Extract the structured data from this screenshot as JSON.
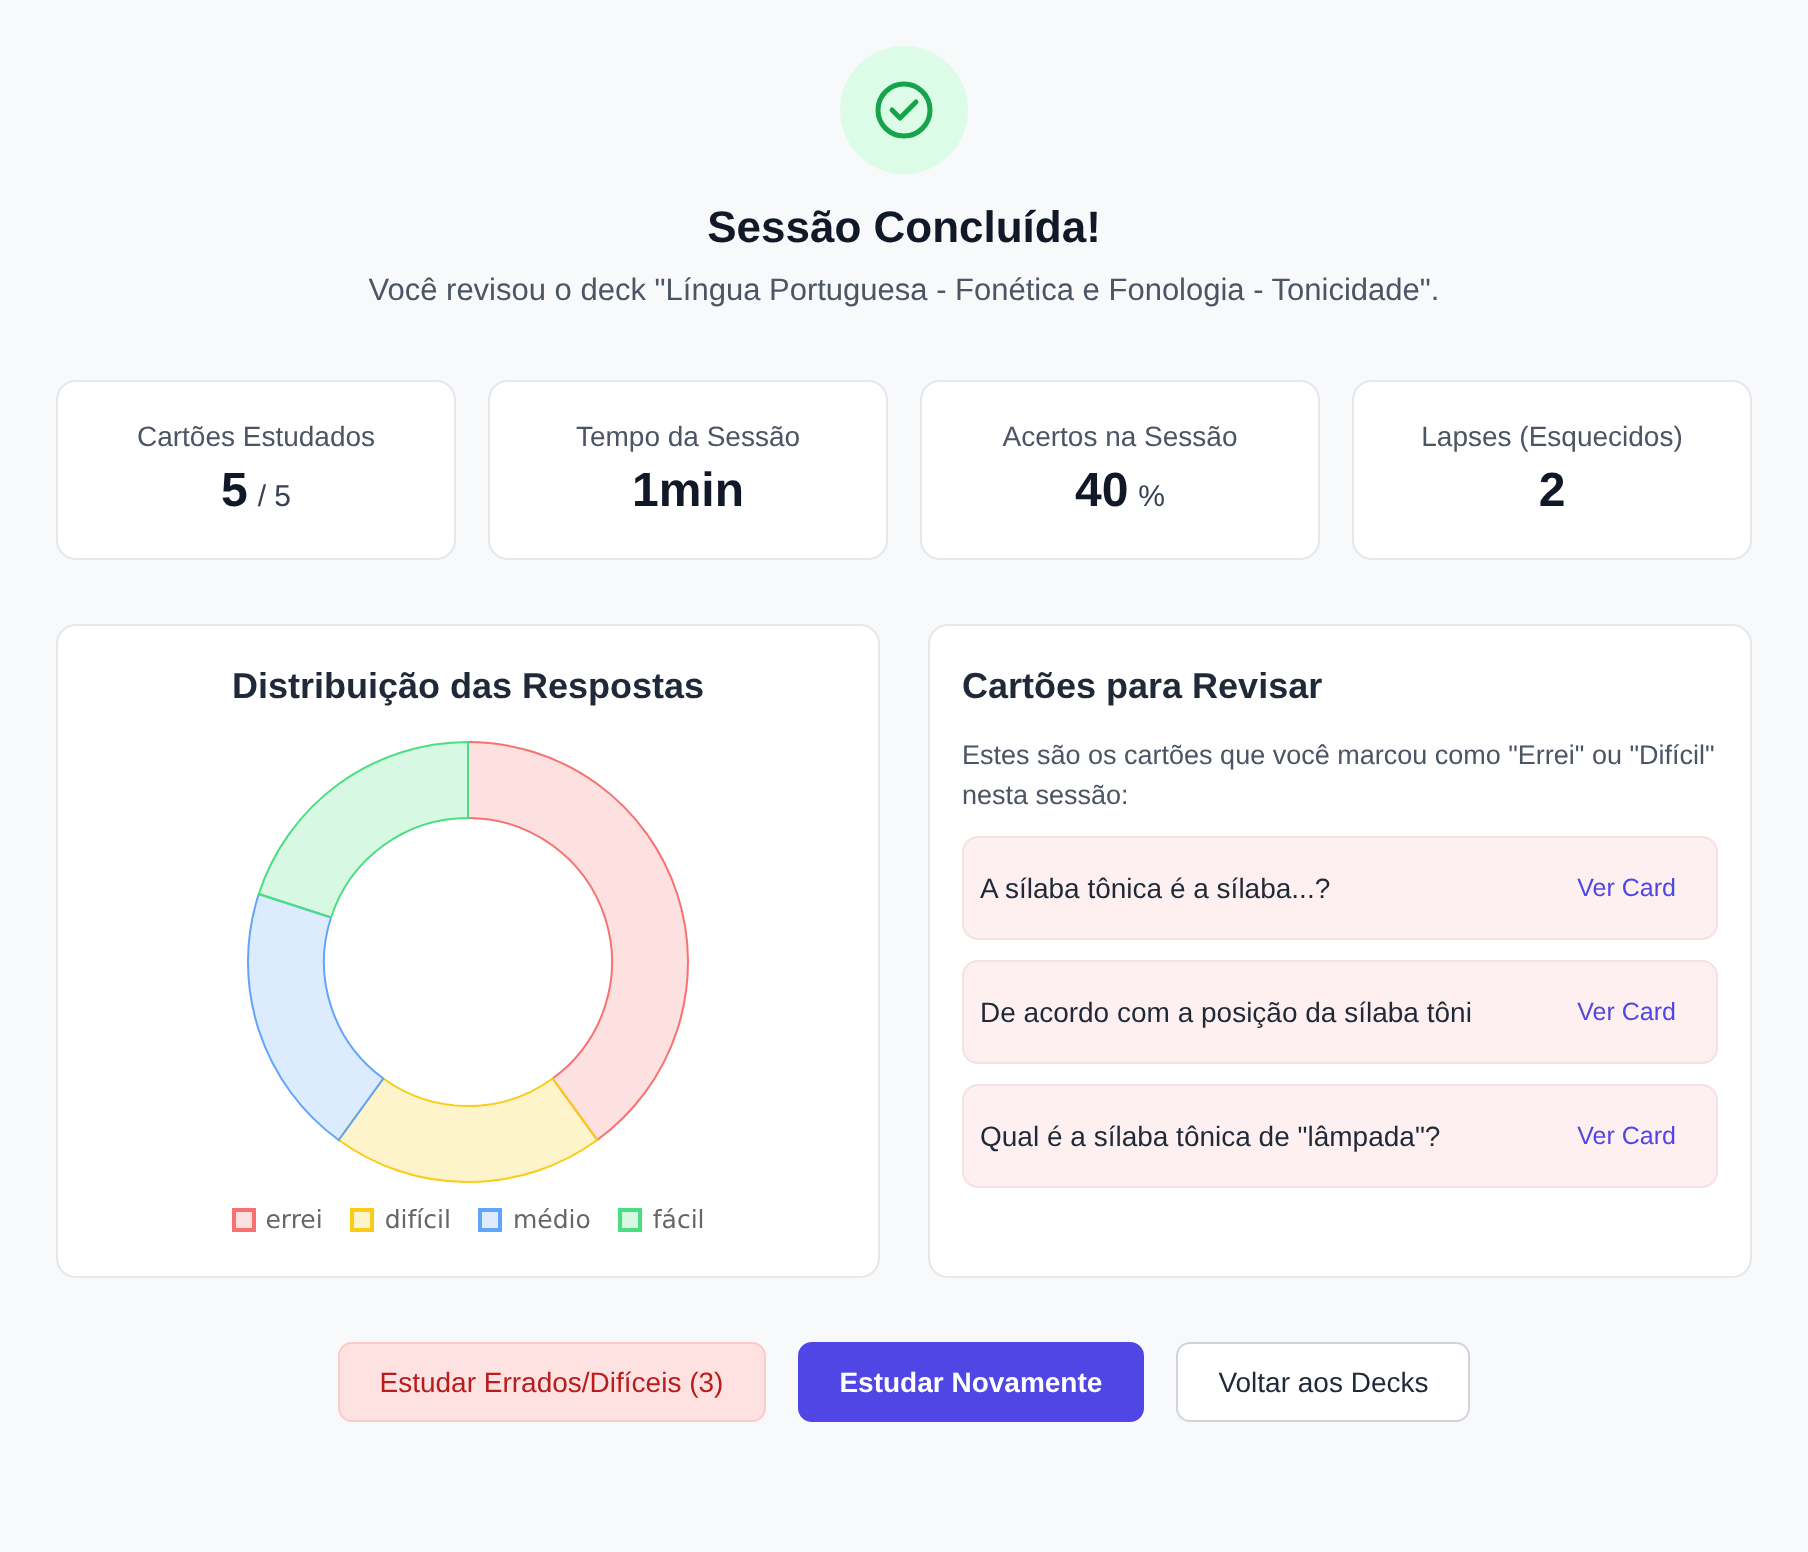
{
  "header": {
    "title": "Sessão Concluída!",
    "subtitle": "Você revisou o deck \"Língua Portuguesa - Fonética e Fonologia - Tonicidade\"."
  },
  "stats": [
    {
      "label": "Cartões Estudados",
      "value": "5",
      "suffix": "/ 5"
    },
    {
      "label": "Tempo da Sessão",
      "value": "1min"
    },
    {
      "label": "Acertos na Sessão",
      "value": "40",
      "suffix": "%"
    },
    {
      "label": "Lapses (Esquecidos)",
      "value": "2"
    }
  ],
  "distribution": {
    "title": "Distribuição das Respostas",
    "chart_data": {
      "type": "donut",
      "categories": [
        "errei",
        "difícil",
        "médio",
        "fácil"
      ],
      "values": [
        40,
        20,
        20,
        20
      ],
      "legend": "bottom",
      "colors": [
        "#f87171",
        "#facc15",
        "#60a5fa",
        "#4ade80"
      ]
    }
  },
  "review": {
    "title": "Cartões para Revisar",
    "description": "Estes são os cartões que você marcou como \"Errei\" ou \"Difícil\" nesta sessão:",
    "cards": [
      {
        "question": "A sílaba tônica é a sílaba...?",
        "action": "Ver Card"
      },
      {
        "question": "De acordo com a posição da sílaba tôni",
        "action": "Ver Card"
      },
      {
        "question": "Qual é a sílaba tônica de \"lâmpada\"?",
        "action": "Ver Card"
      }
    ]
  },
  "buttons": [
    {
      "label": "Estudar Errados/Difíceis (3)",
      "kind": "danger"
    },
    {
      "label": "Estudar Novamente",
      "kind": "primary"
    },
    {
      "label": "Voltar aos Decks",
      "kind": "outline"
    }
  ]
}
